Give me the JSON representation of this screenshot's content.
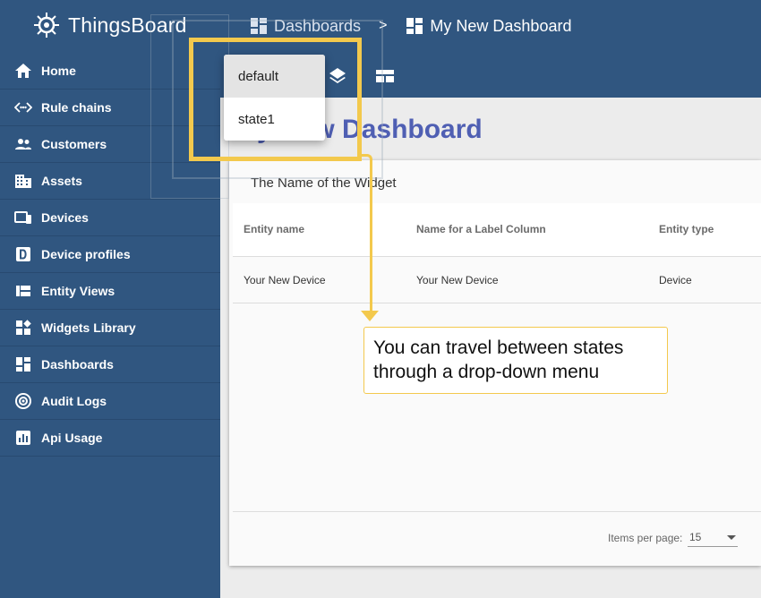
{
  "brand": {
    "name": "ThingsBoard"
  },
  "breadcrumb": {
    "first": "Dashboards",
    "separator": ">",
    "current": "My New Dashboard"
  },
  "sidebar": {
    "items": [
      {
        "label": "Home",
        "icon": "home-icon"
      },
      {
        "label": "Rule chains",
        "icon": "rule-chains-icon"
      },
      {
        "label": "Customers",
        "icon": "customers-icon"
      },
      {
        "label": "Assets",
        "icon": "assets-icon"
      },
      {
        "label": "Devices",
        "icon": "devices-icon"
      },
      {
        "label": "Device profiles",
        "icon": "device-profiles-icon"
      },
      {
        "label": "Entity Views",
        "icon": "entity-views-icon"
      },
      {
        "label": "Widgets Library",
        "icon": "widgets-library-icon"
      },
      {
        "label": "Dashboards",
        "icon": "dashboards-icon"
      },
      {
        "label": "Audit Logs",
        "icon": "audit-logs-icon"
      },
      {
        "label": "Api Usage",
        "icon": "api-usage-icon"
      }
    ]
  },
  "states_menu": {
    "items": [
      "default",
      "state1"
    ],
    "selected": "default"
  },
  "dashboard": {
    "title": "My New Dashboard"
  },
  "widget": {
    "title": "The Name of the Widget",
    "columns": [
      "Entity name",
      "Name for a Label Column",
      "Entity type"
    ],
    "rows": [
      [
        "Your New Device",
        "Your New Device",
        "Device"
      ]
    ],
    "items_per_page_label": "Items per page:",
    "items_per_page_value": "15"
  },
  "callout": {
    "text": "You can travel between states through a drop-down menu"
  },
  "colors": {
    "primary": "#305680",
    "highlight": "#f3c94d",
    "title": "#4f5fb3"
  }
}
